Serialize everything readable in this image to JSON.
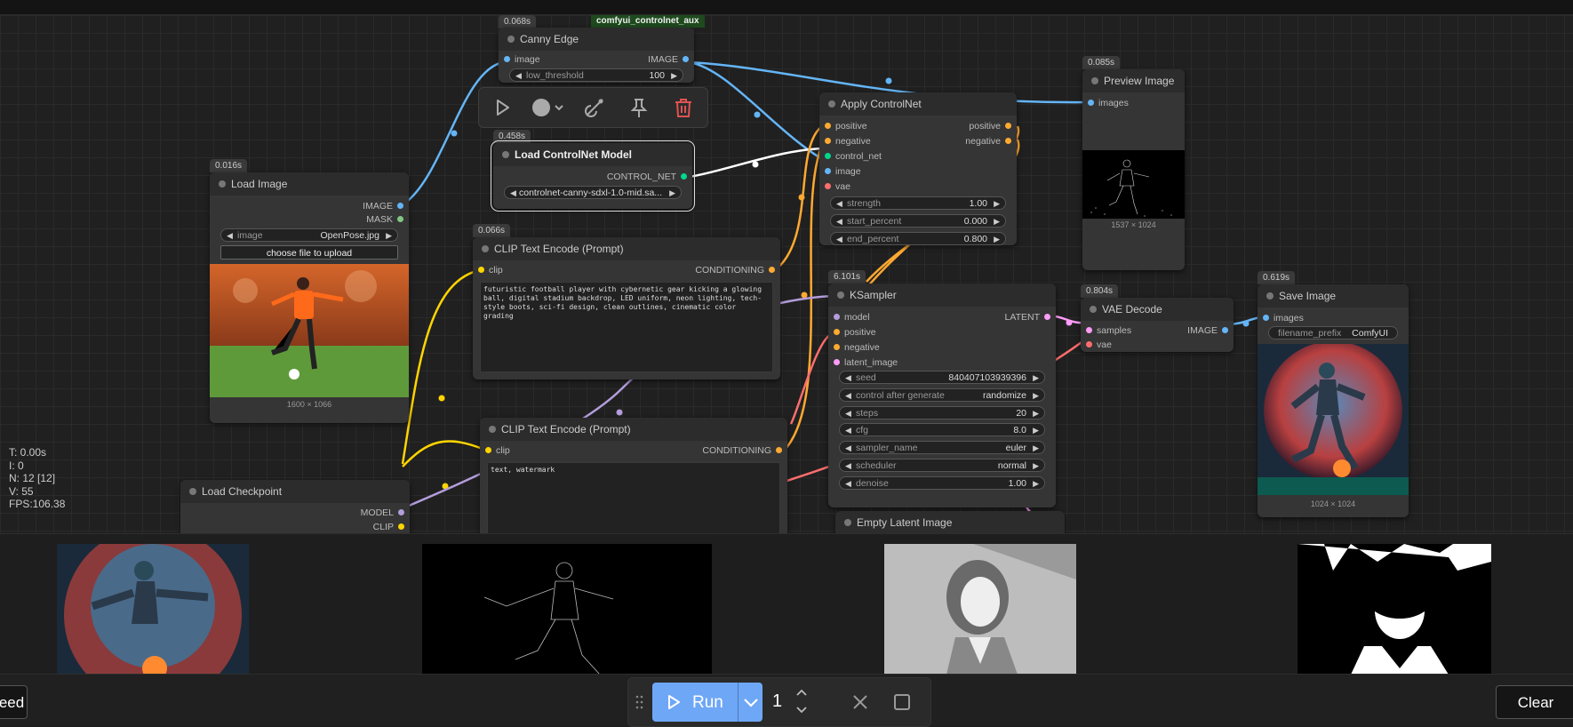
{
  "nodes": {
    "canny": {
      "badge": "0.068s",
      "group_label": "comfyui_controlnet_aux",
      "title": "Canny Edge",
      "in_image": "image",
      "out_image": "IMAGE",
      "widget_label": "low_threshold",
      "widget_value": "100"
    },
    "load_cn": {
      "badge": "0.458s",
      "title": "Load ControlNet Model",
      "out": "CONTROL_NET",
      "widget_value": "controlnet-canny-sdxl-1.0-mid.sa..."
    },
    "load_image": {
      "badge": "0.016s",
      "title": "Load Image",
      "out_image": "IMAGE",
      "out_mask": "MASK",
      "widget_label": "image",
      "widget_value": "OpenPose.jpg",
      "upload": "choose file to upload",
      "caption": "1600 × 1066"
    },
    "clip1": {
      "badge": "0.066s",
      "title": "CLIP Text Encode (Prompt)",
      "in_clip": "clip",
      "out": "CONDITIONING",
      "text": "futuristic football player with cybernetic gear kicking a glowing ball, digital stadium backdrop, LED uniform, neon lighting, tech-style boots, sci-fi design, clean outlines, cinematic color grading"
    },
    "clip2": {
      "title": "CLIP Text Encode (Prompt)",
      "in_clip": "clip",
      "out": "CONDITIONING",
      "text": "text, watermark"
    },
    "apply_cn": {
      "title": "Apply ControlNet",
      "in_positive": "positive",
      "in_negative": "negative",
      "in_control": "control_net",
      "in_image": "image",
      "in_vae": "vae",
      "out_positive": "positive",
      "out_negative": "negative",
      "widgets": [
        {
          "label": "strength",
          "value": "1.00"
        },
        {
          "label": "start_percent",
          "value": "0.000"
        },
        {
          "label": "end_percent",
          "value": "0.800"
        }
      ]
    },
    "preview": {
      "badge": "0.085s",
      "title": "Preview Image",
      "in_images": "images",
      "caption": "1537 × 1024"
    },
    "ksampler": {
      "badge": "6.101s",
      "title": "KSampler",
      "in_model": "model",
      "in_positive": "positive",
      "in_negative": "negative",
      "in_latent": "latent_image",
      "out": "LATENT",
      "widgets": [
        {
          "label": "seed",
          "value": "840407103939396"
        },
        {
          "label": "control after generate",
          "value": "randomize"
        },
        {
          "label": "steps",
          "value": "20"
        },
        {
          "label": "cfg",
          "value": "8.0"
        },
        {
          "label": "sampler_name",
          "value": "euler"
        },
        {
          "label": "scheduler",
          "value": "normal"
        },
        {
          "label": "denoise",
          "value": "1.00"
        }
      ]
    },
    "vae": {
      "badge": "0.804s",
      "title": "VAE Decode",
      "in_samples": "samples",
      "in_vae": "vae",
      "out": "IMAGE"
    },
    "save": {
      "badge": "0.619s",
      "title": "Save Image",
      "in_images": "images",
      "widget_label": "filename_prefix",
      "widget_value": "ComfyUI",
      "caption": "1024 × 1024"
    },
    "checkpoint": {
      "title": "Load Checkpoint",
      "out_model": "MODEL",
      "out_clip": "CLIP"
    },
    "empty_latent": {
      "title": "Empty Latent Image"
    }
  },
  "stats": {
    "t": "T: 0.00s",
    "i": "I: 0",
    "n": "N: 12 [12]",
    "v": "V: 55",
    "fps": "FPS:106.38"
  },
  "bottom": {
    "seed_fragment": "eed",
    "run_label": "Run",
    "count": "1",
    "clear_label": "Clear"
  },
  "colors": {
    "image": "#64b5f6",
    "clip": "#ffd500",
    "conditioning": "#ffa931",
    "control_net": "#00d78d",
    "model": "#b39ddb",
    "latent": "#ff9cf9",
    "vae": "#ff6e6e",
    "mask": "#81c784",
    "accent": "#6ea7f6"
  },
  "icons": [
    "play-icon",
    "color-circle-icon",
    "chevron-down-icon",
    "bypass-icon",
    "pin-icon",
    "trash-icon",
    "drag-handle-icon",
    "close-icon",
    "square-icon",
    "stepper-up-icon",
    "stepper-down-icon"
  ]
}
